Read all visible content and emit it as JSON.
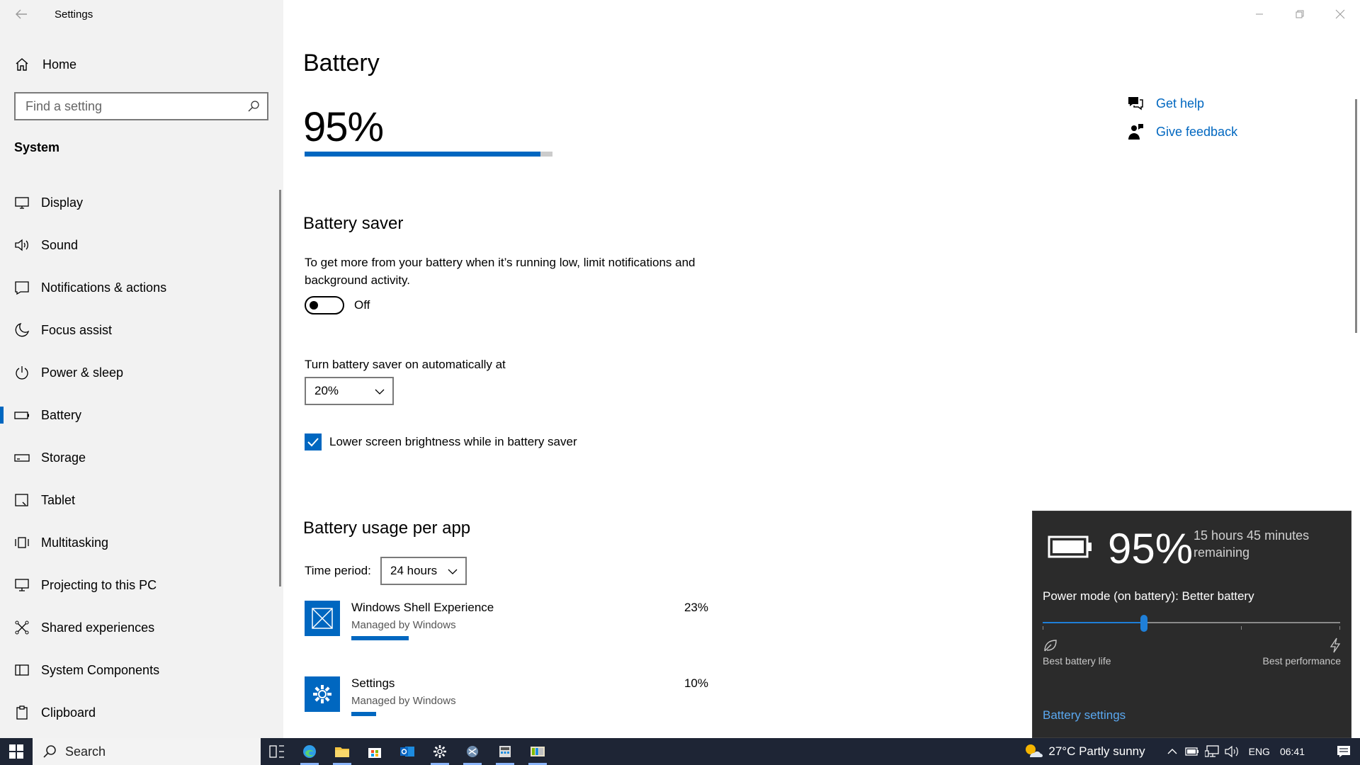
{
  "window": {
    "title": "Settings"
  },
  "sidebar": {
    "home_label": "Home",
    "search_placeholder": "Find a setting",
    "section_title": "System",
    "items": [
      {
        "label": "Display",
        "icon": "monitor-icon"
      },
      {
        "label": "Sound",
        "icon": "speaker-icon"
      },
      {
        "label": "Notifications & actions",
        "icon": "notification-icon"
      },
      {
        "label": "Focus assist",
        "icon": "moon-icon"
      },
      {
        "label": "Power & sleep",
        "icon": "power-icon"
      },
      {
        "label": "Battery",
        "icon": "battery-icon",
        "selected": true
      },
      {
        "label": "Storage",
        "icon": "storage-icon"
      },
      {
        "label": "Tablet",
        "icon": "tablet-icon"
      },
      {
        "label": "Multitasking",
        "icon": "multitasking-icon"
      },
      {
        "label": "Projecting to this PC",
        "icon": "projecting-icon"
      },
      {
        "label": "Shared experiences",
        "icon": "shared-experiences-icon"
      },
      {
        "label": "System Components",
        "icon": "system-components-icon"
      },
      {
        "label": "Clipboard",
        "icon": "clipboard-icon"
      }
    ]
  },
  "main": {
    "title": "Battery",
    "battery_percent": "95%",
    "battery_level": 0.95,
    "battery_saver": {
      "heading": "Battery saver",
      "description": "To get more from your battery when it’s running low, limit notifications and background activity.",
      "toggle_state": "Off",
      "auto_label": "Turn battery saver on automatically at",
      "auto_value": "20%",
      "brightness_label": "Lower screen brightness while in battery saver"
    },
    "usage": {
      "heading": "Battery usage per app",
      "time_period_label": "Time period:",
      "time_period_value": "24 hours",
      "apps": [
        {
          "name": "Windows Shell Experience",
          "sub": "Managed by Windows",
          "percent": "23%",
          "fraction": 0.23
        },
        {
          "name": "Settings",
          "sub": "Managed by Windows",
          "percent": "10%",
          "fraction": 0.1
        }
      ]
    },
    "help": {
      "get_help": "Get help",
      "give_feedback": "Give feedback"
    }
  },
  "flyout": {
    "percent": "95%",
    "remaining": "15 hours 45 minutes remaining",
    "power_mode": "Power mode (on battery): Better battery",
    "slider_level": 0.34,
    "left_label": "Best battery life",
    "right_label": "Best performance",
    "link": "Battery settings"
  },
  "taskbar": {
    "search_label": "Search",
    "weather": "27°C  Partly sunny",
    "language": "ENG",
    "time": "06:41"
  },
  "colors": {
    "accent": "#0067c0",
    "flyout_bg": "#2b2b2b",
    "taskbar_bg": "#1e2535"
  }
}
